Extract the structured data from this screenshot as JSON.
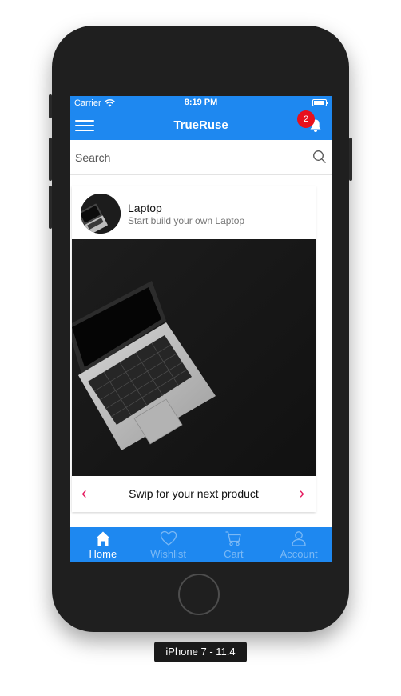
{
  "status_bar": {
    "carrier": "Carrier",
    "time": "8:19 PM"
  },
  "nav": {
    "title": "TrueRuse",
    "notification_count": "2"
  },
  "search": {
    "placeholder": "Search"
  },
  "card": {
    "title": "Laptop",
    "subtitle": "Start build your own Laptop",
    "footer_text": "Swip for your next product",
    "prev_symbol": "‹",
    "next_symbol": "›"
  },
  "tabs": [
    {
      "label": "Home",
      "icon": "home-icon",
      "active": true
    },
    {
      "label": "Wishlist",
      "icon": "heart-icon",
      "active": false
    },
    {
      "label": "Cart",
      "icon": "cart-icon",
      "active": false
    },
    {
      "label": "Account",
      "icon": "user-icon",
      "active": false
    }
  ],
  "device_caption": "iPhone 7 - 11.4",
  "colors": {
    "primary": "#1e88f0",
    "accent": "#e5195e",
    "badge": "#e8101c",
    "inactive_tab": "#7bb9f5"
  }
}
